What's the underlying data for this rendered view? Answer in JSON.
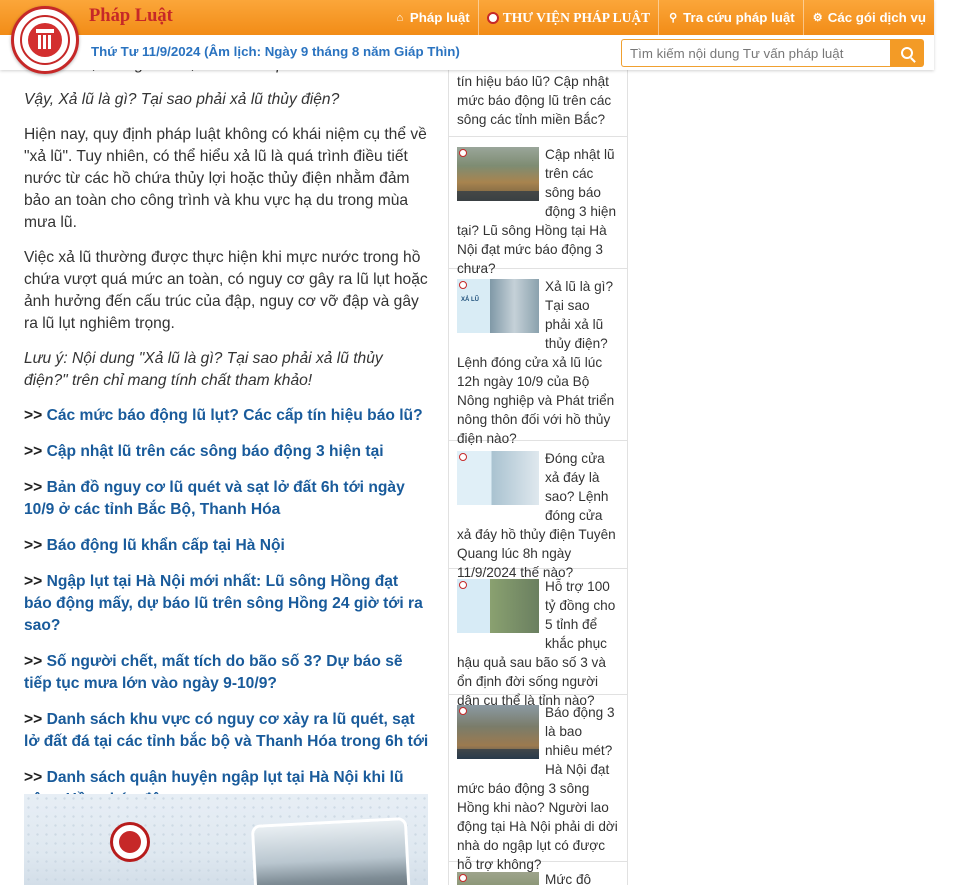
{
  "header": {
    "brand": "Pháp Luật",
    "nav": [
      {
        "label": "Pháp luật",
        "icon": "home-icon"
      },
      {
        "label": "THƯ VIỆN PHÁP LUẬT",
        "icon": "library-logo-icon"
      },
      {
        "label": "Tra cứu pháp luật",
        "icon": "search-icon"
      },
      {
        "label": "Các gói dịch vụ",
        "icon": "service-package-icon"
      }
    ],
    "date": "Thứ Tư 11/9/2024 (Âm lịch: Ngày 9 tháng 8 năm Giáp Thìn)",
    "search_placeholder": "Tìm kiếm nội dung Tư vấn pháp luật"
  },
  "article": {
    "cut_line": "lên nhanh, xuống nhanh, có sức tàn phá lớn.",
    "question": "Vậy, Xả lũ là gì? Tại sao phải xả lũ thủy điện?",
    "p1": "Hiện nay, quy định pháp luật không có khái niệm cụ thể về \"xả lũ\". Tuy nhiên, có thể hiểu xả lũ là quá trình điều tiết nước từ các hồ chứa thủy lợi hoặc thủy điện nhằm đảm bảo an toàn cho công trình và khu vực hạ du trong mùa mưa lũ.",
    "p2": "Việc xả lũ thường được thực hiện khi mực nước trong hồ chứa vượt quá mức an toàn, có nguy cơ gây ra lũ lụt hoặc ảnh hưởng đến cấu trúc của đập, nguy cơ vỡ đập và gây ra lũ lụt nghiêm trọng.",
    "note": "Lưu ý: Nội dung \"Xả lũ là gì? Tại sao phải xả lũ thủy điện?\" trên chỉ mang tính chất tham khảo!",
    "arrow": ">>",
    "links": [
      "Các mức báo động lũ lụt? Các cấp tín hiệu báo lũ?",
      "Cập nhật lũ trên các sông báo động 3 hiện tại",
      "Bản đồ nguy cơ lũ quét và sạt lở đất 6h tới ngày 10/9 ở các tỉnh Bắc Bộ, Thanh Hóa",
      "Báo động lũ khẩn cấp tại Hà Nội",
      "Ngập lụt tại Hà Nội mới nhất: Lũ sông Hồng đạt báo động mấy, dự báo lũ trên sông Hồng 24 giờ tới ra sao?",
      "Số người chết, mất tích do bão số 3? Dự báo sẽ tiếp tục mưa lớn vào ngày 9-10/9?",
      "Danh sách khu vực có nguy cơ xảy ra lũ quét, sạt lở đất đá tại các tỉnh bắc bộ và Thanh Hóa trong 6h tới",
      "Danh sách quận huyện ngập lụt tại Hà Nội khi lũ sông Hồng báo động cao"
    ]
  },
  "sidebar": {
    "top_text": "tín hiệu báo lũ? Cập nhật mức báo động lũ trên các sông các tỉnh miền Bắc?",
    "items": [
      {
        "title": "Cập nhật lũ trên các sông báo động 3 hiện tại? Lũ sông Hồng tại Hà Nội đạt mức báo động 3 chưa?"
      },
      {
        "title": "Xả lũ là gì? Tại sao phải xả lũ thủy điện? Lệnh đóng cửa xả lũ lúc 12h ngày 10/9 của Bộ Nông nghiệp và Phát triển nông thôn đối với hồ thủy điện nào?",
        "thumb_label": "XẢ LŨ"
      },
      {
        "title": "Đóng cửa xả đáy là sao? Lệnh đóng cửa xả đáy hồ thủy điện Tuyên Quang lúc 8h ngày 11/9/2024 thế nào?"
      },
      {
        "title": "Hỗ trợ 100 tỷ đồng cho 5 tỉnh để khắc phục hậu quả sau bão số 3 và ổn định đời sống người dân cụ thể là tỉnh nào?"
      },
      {
        "title": "Báo động 3 là bao nhiêu mét? Hà Nội đạt mức báo động 3 sông Hồng khi nào? Người lao động tại Hà Nội phải di dời nhà do ngập lụt có được hỗ trợ không?"
      },
      {
        "title": "Mức độ nguy"
      }
    ]
  }
}
